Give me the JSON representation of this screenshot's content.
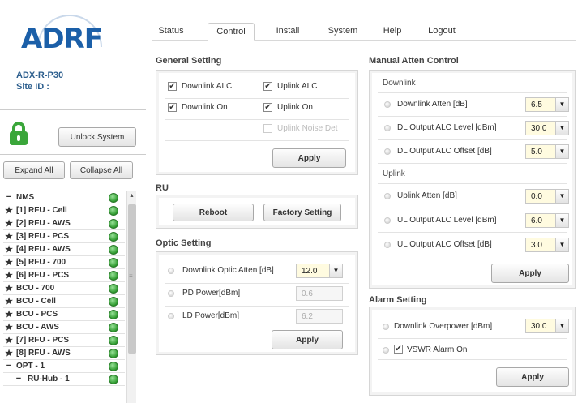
{
  "brand": {
    "logo_text": "ADRF"
  },
  "device": {
    "model": "ADX-R-P30",
    "site_id_label": "Site ID :"
  },
  "sidebar": {
    "unlock_label": "Unlock System",
    "expand_label": "Expand All",
    "collapse_label": "Collapse All",
    "tree": [
      {
        "mark": "−",
        "label": "NMS"
      },
      {
        "mark": "★",
        "label": "[1] RFU - Cell"
      },
      {
        "mark": "★",
        "label": "[2] RFU - AWS"
      },
      {
        "mark": "★",
        "label": "[3] RFU - PCS"
      },
      {
        "mark": "★",
        "label": "[4] RFU - AWS"
      },
      {
        "mark": "★",
        "label": "[5] RFU - 700"
      },
      {
        "mark": "★",
        "label": "[6] RFU - PCS"
      },
      {
        "mark": "★",
        "label": "BCU - 700"
      },
      {
        "mark": "★",
        "label": "BCU - Cell"
      },
      {
        "mark": "★",
        "label": "BCU - PCS"
      },
      {
        "mark": "★",
        "label": "BCU - AWS"
      },
      {
        "mark": "★",
        "label": "[7] RFU - PCS"
      },
      {
        "mark": "★",
        "label": "[8] RFU - AWS"
      },
      {
        "mark": "−",
        "label": "OPT - 1"
      },
      {
        "mark": "−",
        "label": "RU-Hub - 1"
      }
    ],
    "status_color": "#2e9a2e"
  },
  "tabs": [
    "Status",
    "Control",
    "Install",
    "System",
    "Help",
    "Logout"
  ],
  "active_tab": "Control",
  "general": {
    "title": "General Setting",
    "downlink_alc": "Downlink ALC",
    "uplink_alc": "Uplink ALC",
    "downlink_on": "Downlink On",
    "uplink_on": "Uplink On",
    "uplink_noise_det": "Uplink Noise Det",
    "apply": "Apply"
  },
  "ru": {
    "title": "RU",
    "reboot": "Reboot",
    "factory": "Factory Setting"
  },
  "optic": {
    "title": "Optic Setting",
    "dl_optic_atten_label": "Downlink Optic Atten [dB]",
    "dl_optic_atten_value": "12.0",
    "pd_power_label": "PD Power[dBm]",
    "pd_power_value": "0.6",
    "ld_power_label": "LD Power[dBm]",
    "ld_power_value": "6.2",
    "apply": "Apply"
  },
  "manual": {
    "title": "Manual Atten Control",
    "downlink_title": "Downlink",
    "uplink_title": "Uplink",
    "rows": [
      {
        "label": "Downlink Atten [dB]",
        "value": "6.5"
      },
      {
        "label": "DL Output ALC Level [dBm]",
        "value": "30.0"
      },
      {
        "label": "DL Output ALC Offset [dB]",
        "value": "5.0"
      },
      {
        "label": "Uplink Atten [dB]",
        "value": "0.0"
      },
      {
        "label": "UL Output ALC Level [dBm]",
        "value": "6.0"
      },
      {
        "label": "UL Output ALC Offset [dB]",
        "value": "3.0"
      }
    ],
    "apply": "Apply"
  },
  "alarm": {
    "title": "Alarm Setting",
    "dl_overpower_label": "Downlink Overpower [dBm]",
    "dl_overpower_value": "30.0",
    "vswr_label": "VSWR Alarm On",
    "apply": "Apply"
  },
  "colors": {
    "logo": "#1b5fa8",
    "info": "#2d5f8e",
    "lock": "#3aa63a",
    "field_bg": "#fffbe0"
  }
}
